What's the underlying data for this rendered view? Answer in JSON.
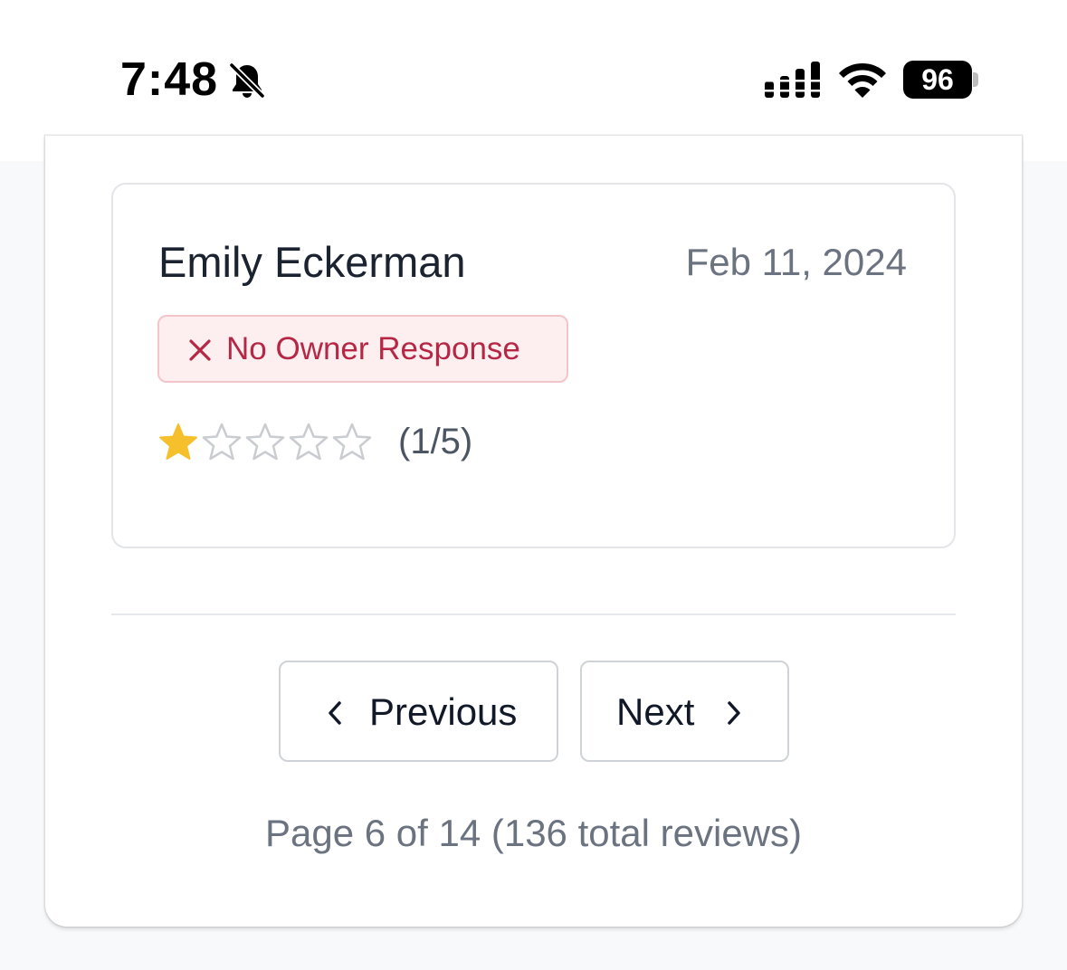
{
  "status_bar": {
    "time": "7:48",
    "battery_level": "96",
    "icons": [
      "bell-slash-icon",
      "cellular-signal-icon",
      "wifi-icon",
      "battery-icon"
    ]
  },
  "review": {
    "reviewer_name": "Emily Eckerman",
    "date": "Feb 11, 2024",
    "badge": {
      "icon": "x-icon",
      "label": "No Owner Response",
      "text_color": "#b52744",
      "background": "#fdeef0"
    },
    "rating": {
      "value": 1,
      "max": 5,
      "label": "(1/5)",
      "filled_color": "#f5c02b"
    }
  },
  "pagination": {
    "previous_label": "Previous",
    "next_label": "Next",
    "page_info": "Page 6 of 14 (136 total reviews)"
  }
}
